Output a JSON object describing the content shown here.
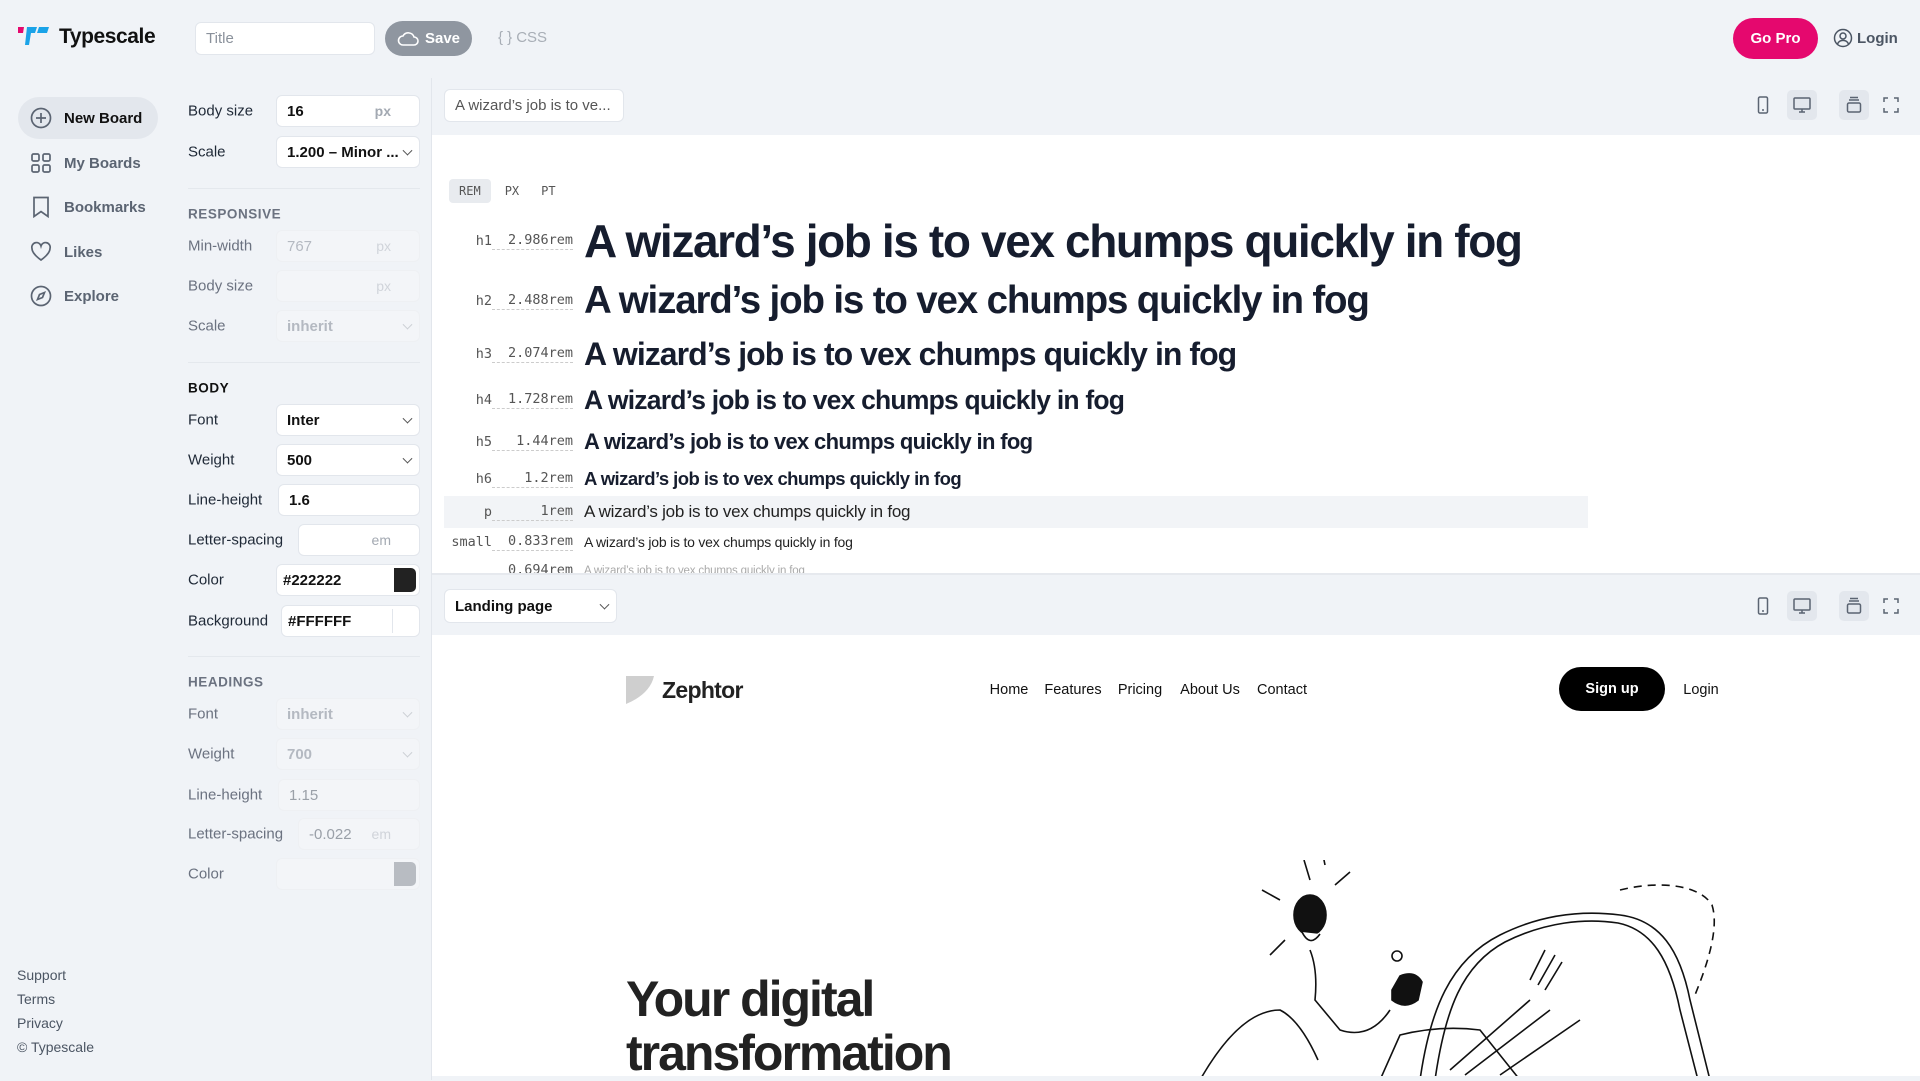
{
  "app": {
    "name": "Typescale",
    "title_placeholder": "Title",
    "save_label": "Save",
    "css_label": "CSS",
    "go_pro_label": "Go Pro",
    "login_label": "Login",
    "brand_color": "#e5086e"
  },
  "sidebar": {
    "items": [
      {
        "label": "New Board",
        "icon": "plus-circle-icon"
      },
      {
        "label": "My Boards",
        "icon": "grid-icon"
      },
      {
        "label": "Bookmarks",
        "icon": "bookmark-icon"
      },
      {
        "label": "Likes",
        "icon": "heart-icon"
      },
      {
        "label": "Explore",
        "icon": "compass-icon"
      }
    ],
    "footer": [
      "Support",
      "Terms",
      "Privacy",
      "© Typescale"
    ]
  },
  "settings": {
    "body_size": {
      "label": "Body size",
      "value": "16",
      "unit": "px"
    },
    "scale": {
      "label": "Scale",
      "value": "1.200 – Minor ..."
    },
    "responsive": {
      "heading": "RESPONSIVE",
      "min_width": {
        "label": "Min-width",
        "placeholder": "767",
        "unit": "px"
      },
      "body_size": {
        "label": "Body size",
        "unit": "px"
      },
      "scale": {
        "label": "Scale",
        "value": "inherit"
      }
    },
    "body": {
      "heading": "BODY",
      "font": {
        "label": "Font",
        "value": "Inter"
      },
      "weight": {
        "label": "Weight",
        "value": "500"
      },
      "line_height": {
        "label": "Line-height",
        "value": "1.6"
      },
      "letter_spacing": {
        "label": "Letter-spacing",
        "unit": "em"
      },
      "color": {
        "label": "Color",
        "value": "#222222"
      },
      "background": {
        "label": "Background",
        "value": "#FFFFFF"
      }
    },
    "headings": {
      "heading": "HEADINGS",
      "font": {
        "label": "Font",
        "value": "inherit"
      },
      "weight": {
        "label": "Weight",
        "value": "700"
      },
      "line_height": {
        "label": "Line-height",
        "value": "1.15"
      },
      "letter_spacing": {
        "label": "Letter-spacing",
        "value": "-0.022",
        "unit": "em"
      },
      "color": {
        "label": "Color",
        "swatch": "#b8bcc2"
      }
    }
  },
  "preview": {
    "text_input": "A wizard’s job is to ve...",
    "units": [
      "REM",
      "PX",
      "PT"
    ],
    "active_unit": "REM",
    "sample": "A wizard’s job is to vex chumps quickly in fog",
    "rows": [
      {
        "tag": "h1",
        "size": "2.986rem"
      },
      {
        "tag": "h2",
        "size": "2.488rem"
      },
      {
        "tag": "h3",
        "size": "2.074rem"
      },
      {
        "tag": "h4",
        "size": "1.728rem"
      },
      {
        "tag": "h5",
        "size": "1.44rem"
      },
      {
        "tag": "h6",
        "size": "1.2rem"
      },
      {
        "tag": "p",
        "size": "1rem"
      },
      {
        "tag": "small",
        "size": "0.833rem"
      },
      {
        "tag": "",
        "size": "0.694rem"
      }
    ]
  },
  "landing": {
    "template": "Landing page",
    "brand": "Zephtor",
    "nav": [
      "Home",
      "Features",
      "Pricing",
      "About Us",
      "Contact"
    ],
    "signup": "Sign up",
    "login": "Login",
    "hero": [
      "Your digital",
      "transformation"
    ]
  }
}
